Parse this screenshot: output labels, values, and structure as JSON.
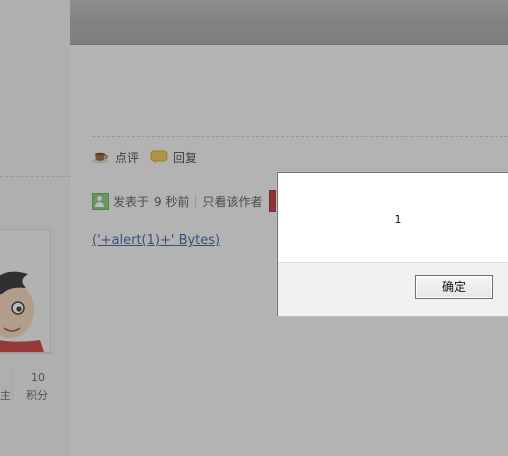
{
  "post": {
    "actions": [
      {
        "label": "点评",
        "icon": "coffee-cup-icon"
      },
      {
        "label": "回复",
        "icon": "speech-bubble-icon"
      }
    ],
    "meta": {
      "posted_label": "发表于",
      "posted_time": "9 秒前",
      "author_only": "只看该作者"
    },
    "link_text": "('+alert(1)+' Bytes)"
  },
  "profile": {
    "stats": [
      {
        "label": "积分",
        "value": "10"
      }
    ],
    "partial_label": "主"
  },
  "dialog": {
    "message": "1",
    "ok_label": "确定"
  },
  "colors": {
    "link": "#2a4f94",
    "overlay": "#505050",
    "author_chip": "#b82222"
  }
}
